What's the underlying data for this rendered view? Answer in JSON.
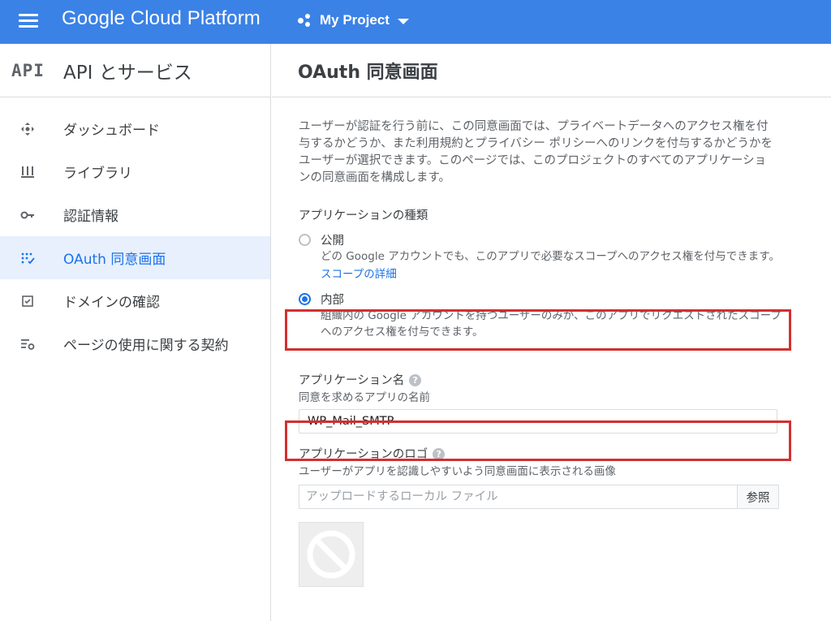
{
  "topbar": {
    "brand": "Google Cloud Platform",
    "project": "My Project"
  },
  "sidebar": {
    "logo": "API",
    "title": "API とサービス",
    "items": [
      {
        "label": "ダッシュボード",
        "icon": "dashboard-icon",
        "active": false
      },
      {
        "label": "ライブラリ",
        "icon": "library-icon",
        "active": false
      },
      {
        "label": "認証情報",
        "icon": "key-icon",
        "active": false
      },
      {
        "label": "OAuth 同意画面",
        "icon": "consent-icon",
        "active": true
      },
      {
        "label": "ドメインの確認",
        "icon": "checkbox-icon",
        "active": false
      },
      {
        "label": "ページの使用に関する契約",
        "icon": "settings-list-icon",
        "active": false
      }
    ]
  },
  "main": {
    "title": "OAuth 同意画面",
    "description": "ユーザーが認証を行う前に、この同意画面では、プライベートデータへのアクセス権を付与するかどうか、また利用規約とプライバシー ポリシーへのリンクを付与するかどうかをユーザーが選択できます。このページでは、このプロジェクトのすべてのアプリケーションの同意画面を構成します。",
    "app_type": {
      "label": "アプリケーションの種類",
      "public": {
        "title": "公開",
        "desc": "どの Google アカウントでも、このアプリで必要なスコープへのアクセス権を付与できます。",
        "link": "スコープの詳細",
        "selected": false
      },
      "internal": {
        "title": "内部",
        "desc": "組織内の Google アカウントを持つユーザーのみが、このアプリでリクエストされたスコープへのアクセス権を付与できます。",
        "selected": true
      }
    },
    "app_name": {
      "label": "アプリケーション名",
      "sub": "同意を求めるアプリの名前",
      "value": "WP_Mail_SMTP"
    },
    "app_logo": {
      "label": "アプリケーションのロゴ",
      "sub": "ユーザーがアプリを認識しやすいよう同意画面に表示される画像",
      "placeholder": "アップロードするローカル ファイル",
      "browse": "参照"
    }
  },
  "colors": {
    "topbar": "#3b82e6",
    "accent": "#1a73e8",
    "highlight": "#d32f2f"
  }
}
